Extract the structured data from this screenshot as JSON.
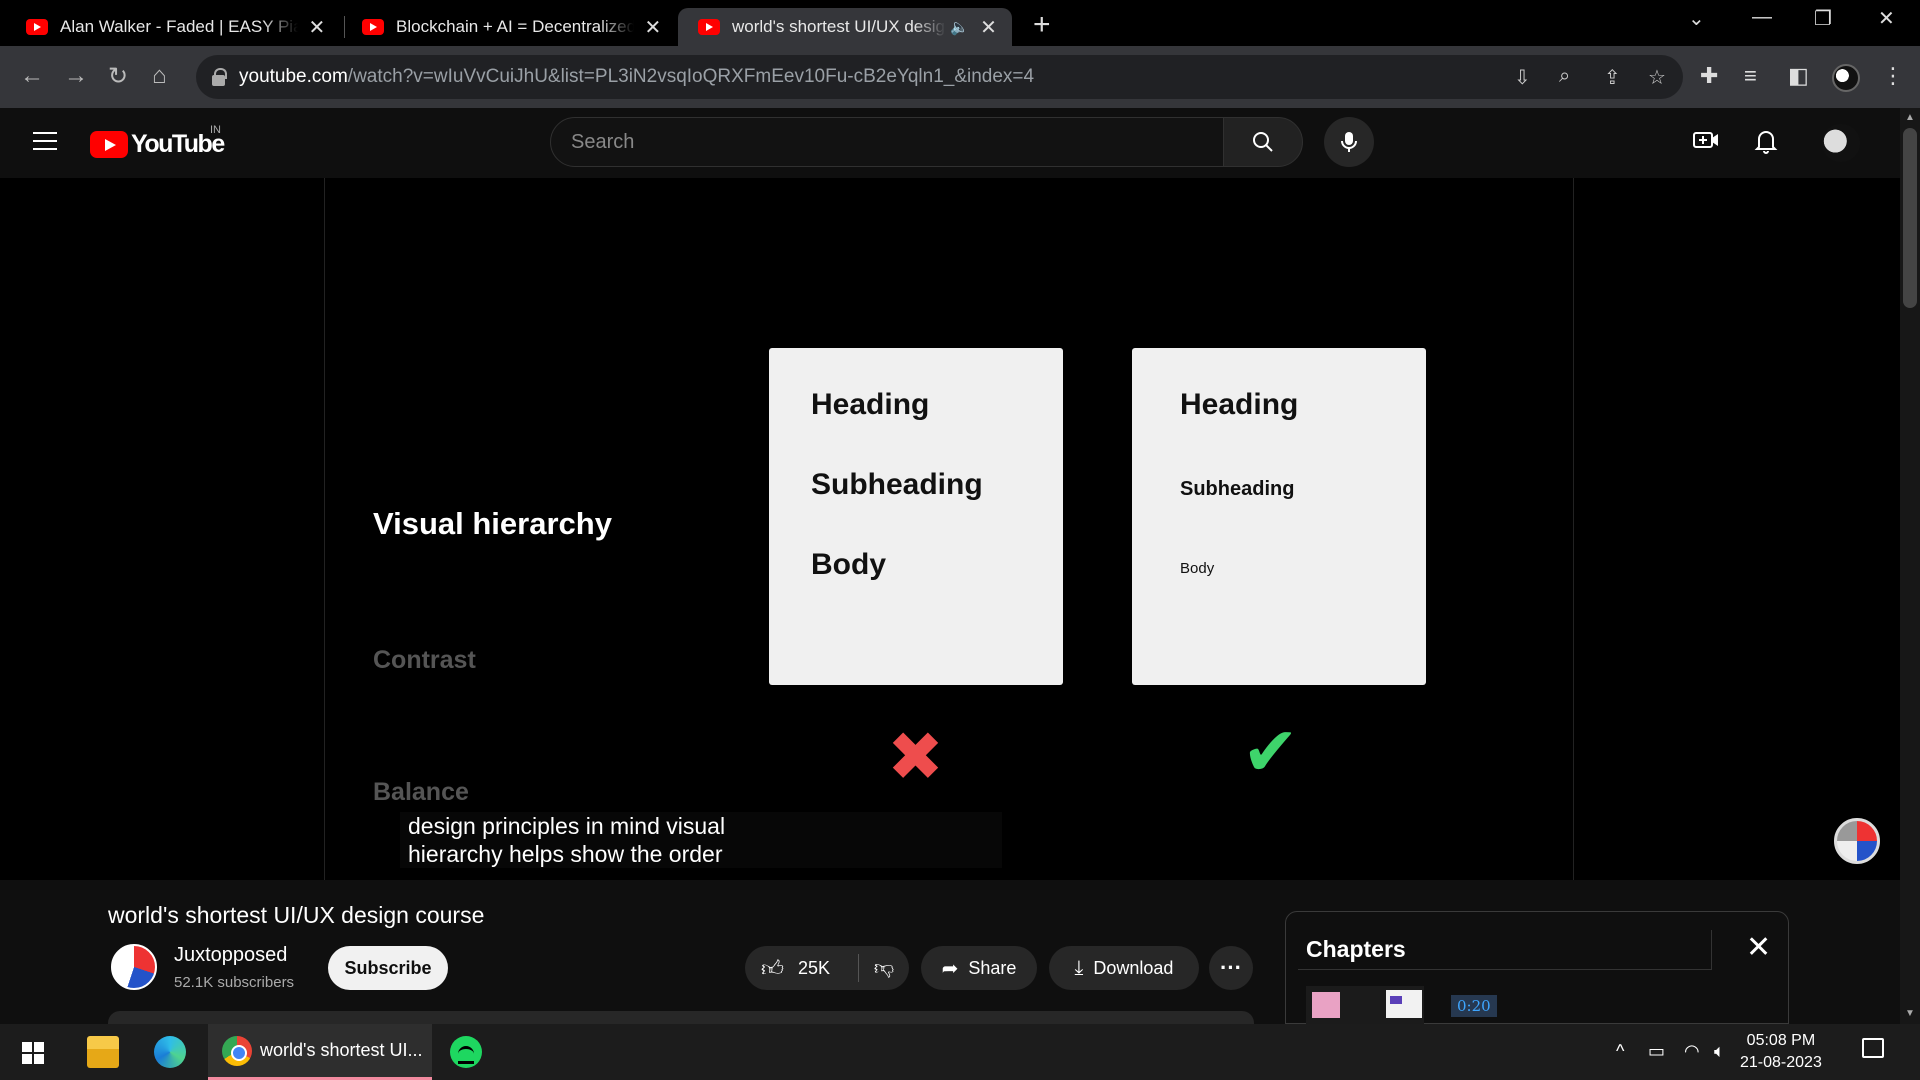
{
  "browser": {
    "tabs": [
      {
        "title": "Alan Walker - Faded | EASY Piano"
      },
      {
        "title": "Blockchain + AI = Decentralized AI"
      },
      {
        "title": "world's shortest UI/UX design course"
      }
    ],
    "url_host": "youtube.com",
    "url_path": "/watch?v=wIuVvCuiJhU&list=PL3iN2vsqIoQRXFmEev10Fu-cB2eYqln1_&index=4"
  },
  "youtube_header": {
    "logo_text": "YouTube",
    "country_code": "IN",
    "search_placeholder": "Search"
  },
  "video": {
    "slide": {
      "topics": [
        "Visual hierarchy",
        "Contrast",
        "Balance"
      ],
      "bad_card": {
        "heading": "Heading",
        "subheading": "Subheading",
        "body": "Body"
      },
      "good_card": {
        "heading": "Heading",
        "subheading": "Subheading",
        "body": "Body"
      },
      "bad_mark": "✖",
      "good_mark": "✔"
    },
    "caption_line1": "design principles in mind visual",
    "caption_line2": "hierarchy helps show the order"
  },
  "meta": {
    "title": "world's shortest UI/UX design course",
    "channel_name": "Juxtopposed",
    "subscribers": "52.1K subscribers",
    "subscribe_label": "Subscribe",
    "likes": "25K",
    "share_label": "Share",
    "download_label": "Download"
  },
  "chapters": {
    "title": "Chapters",
    "first_time": "0:20"
  },
  "taskbar": {
    "chrome_label": "world's shortest UI...",
    "time": "05:08 PM",
    "date": "21-08-2023"
  }
}
